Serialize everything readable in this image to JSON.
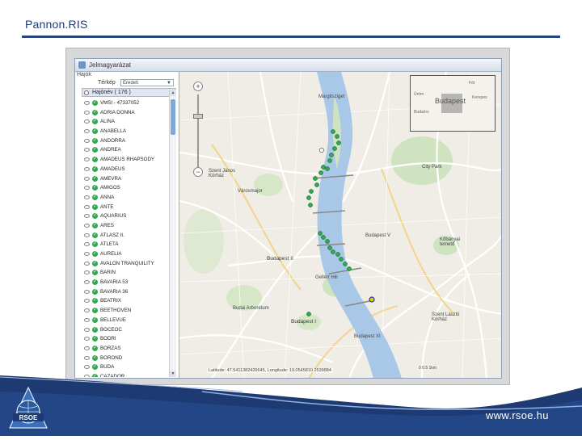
{
  "slide": {
    "title": "Pannon.RIS",
    "footer_url": "www.rsoe.hu",
    "logo_text": "RSOE"
  },
  "app": {
    "window_title": "Jelmagyarázat"
  },
  "panel": {
    "header": "Hajók",
    "map_label": "Térkép",
    "map_select_value": "Eredeti",
    "group_label": "Hajónév ( 176 )",
    "vessels": [
      "VMSI - 47337052",
      "ADRIA DONNA",
      "ALINA",
      "ANABELLA",
      "ANDORRA",
      "ANDREA",
      "AMADEUS RHAPSODY",
      "AMADEUS",
      "AMEVRA",
      "AMIGOS",
      "ANNA",
      "ANTE",
      "AQUARIUS",
      "ARES",
      "ATLASZ II.",
      "ATLETA",
      "AURELIA",
      "AVALON TRANQUILITY",
      "BARIN",
      "BAVARIA 53",
      "BAVARIA 36",
      "BEATRIX",
      "BEETHOVEN",
      "BELLEVUE",
      "BOCEOC",
      "BODRI",
      "BORZAS",
      "BOROND",
      "BUDA",
      "CAZADOR"
    ]
  },
  "map": {
    "places": [
      "Margitsziget",
      "City Park",
      "Szent János Kórház",
      "Városmajor",
      "Budapest II",
      "Budapest I",
      "Gellért Hill",
      "Budapest XI",
      "Budapest V",
      "Budai Arborétum",
      "Kőbányai temető",
      "Szent László Kórház"
    ],
    "overview_city": "Budapest",
    "overview_labels": [
      "Üröm",
      "Fót",
      "Budaörs",
      "Kerepes"
    ],
    "coord_text": "Latitude: 47.5411382426645, Longitude: 19.0545810 2539884",
    "scale_text": "0   0.5   1km"
  },
  "colors": {
    "accent": "#27457a",
    "vessel_marker": "#2fa84f",
    "river": "#a9c8e8"
  }
}
